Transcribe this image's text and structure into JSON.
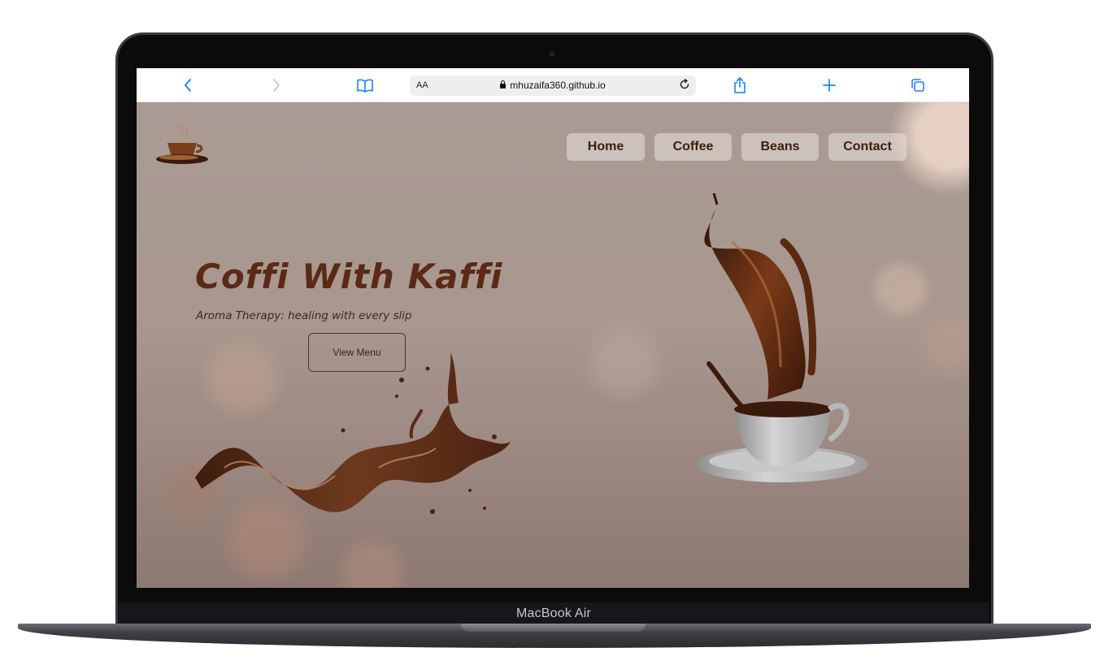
{
  "device": {
    "label": "MacBook Air"
  },
  "browser": {
    "url": "mhuzaifa360.github.io",
    "reader_label": "AA",
    "icons": {
      "back": "chevron-left-icon",
      "forward": "chevron-right-icon",
      "bookmarks": "book-icon",
      "reload": "reload-icon",
      "share": "share-icon",
      "new_tab": "plus-icon",
      "tabs": "tabs-icon"
    }
  },
  "site": {
    "nav": [
      {
        "label": "Home"
      },
      {
        "label": "Coffee"
      },
      {
        "label": "Beans"
      },
      {
        "label": "Contact"
      }
    ],
    "hero": {
      "title": "Coffi With Kaffi",
      "subtitle": "Aroma Therapy: healing with every slip",
      "cta_label": "View Menu"
    },
    "colors": {
      "accent_text": "#5a2a16",
      "safari_blue": "#1a82f7"
    }
  }
}
